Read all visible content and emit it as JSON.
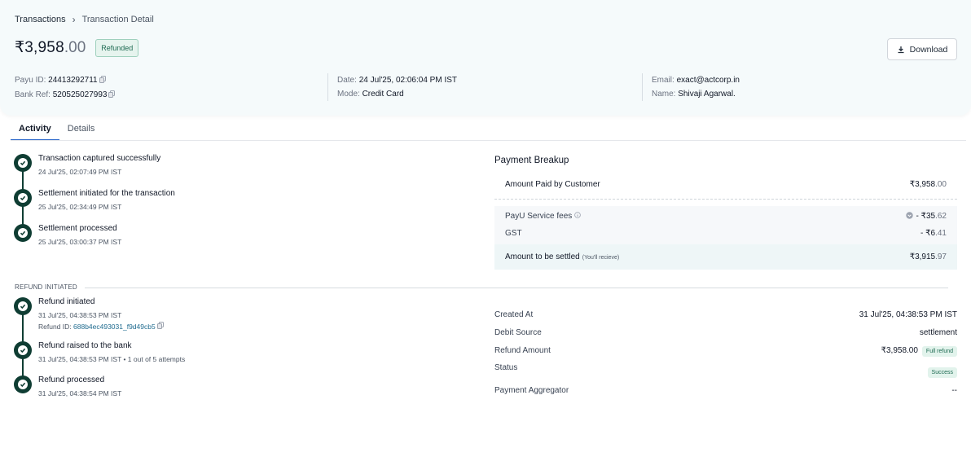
{
  "breadcrumb": {
    "parent": "Transactions",
    "separator": "›",
    "current": "Transaction Detail"
  },
  "transaction": {
    "amount_main": "₹3,958",
    "amount_decimal": ".00",
    "status_badge": "Refunded",
    "download_label": "Download"
  },
  "meta": {
    "payu_id_label": "Payu ID:",
    "payu_id": "24413292711",
    "bank_ref_label": "Bank Ref:",
    "bank_ref": "520525027993",
    "date_label": "Date:",
    "date": "24 Jul'25, 02:06:04 PM IST",
    "mode_label": "Mode:",
    "mode": "Credit Card",
    "email_label": "Email:",
    "email": "exact@actcorp.in",
    "name_label": "Name:",
    "name": "Shivaji Agarwal."
  },
  "tabs": [
    {
      "label": "Activity",
      "active": true
    },
    {
      "label": "Details",
      "active": false
    }
  ],
  "timeline": [
    {
      "title": "Transaction captured successfully",
      "time": "24 Jul'25, 02:07:49 PM IST"
    },
    {
      "title": "Settlement initiated for the transaction",
      "time": "25 Jul'25, 02:34:49 PM IST"
    },
    {
      "title": "Settlement processed",
      "time": "25 Jul'25, 03:00:37 PM IST"
    }
  ],
  "refund_section_label": "REFUND INITIATED",
  "refund_timeline": [
    {
      "title": "Refund initiated",
      "time": "31 Jul'25, 04:38:53 PM IST",
      "ref_label": "Refund ID:",
      "ref_id": "688b4ec493031_f9d49cb5"
    },
    {
      "title": "Refund raised to the bank",
      "time": "31 Jul'25, 04:38:53 PM IST • 1 out of 5 attempts"
    },
    {
      "title": "Refund processed",
      "time": "31 Jul'25, 04:38:54 PM IST"
    }
  ],
  "payment_breakup": {
    "title": "Payment Breakup",
    "paid_label": "Amount Paid by Customer",
    "paid_main": "₹3,958",
    "paid_dec": ".00",
    "fees_label": "PayU Service fees",
    "fees_main": "- ₹35",
    "fees_dec": ".62",
    "gst_label": "GST",
    "gst_main": "- ₹6",
    "gst_dec": ".41",
    "settled_label": "Amount to be settled",
    "settled_note": "(You'll recieve)",
    "settled_main": "₹3,915",
    "settled_dec": ".97"
  },
  "refund_details": {
    "created_label": "Created At",
    "created_value": "31 Jul'25, 04:38:53 PM IST",
    "debit_label": "Debit Source",
    "debit_value": "settlement",
    "amount_label": "Refund Amount",
    "amount_value": "₹3,958.00",
    "amount_pill": "Full refund",
    "status_label": "Status",
    "status_value": "Success",
    "aggregator_label": "Payment Aggregator",
    "aggregator_value": "--"
  },
  "colors": {
    "timeline_dot": "#0f3d33",
    "active_tab": "#2563c9",
    "header_bg": "#f5fafb"
  }
}
